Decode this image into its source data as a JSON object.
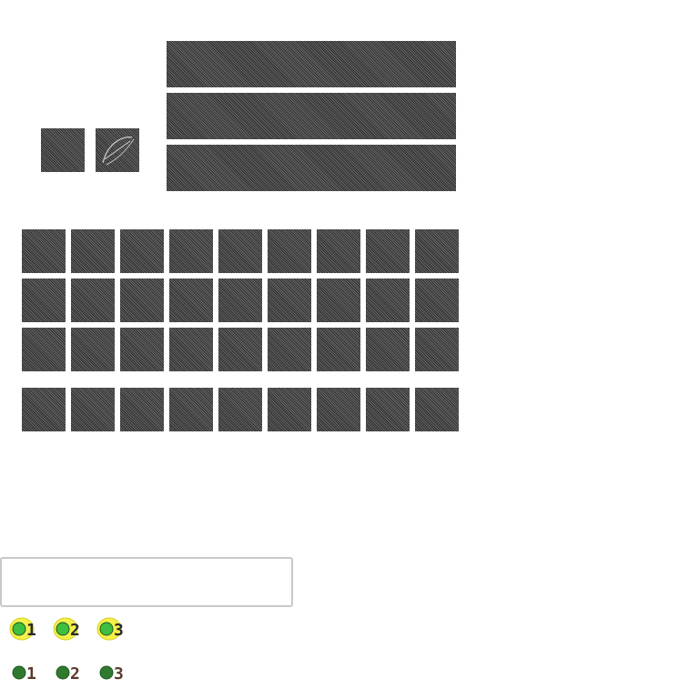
{
  "armor_slots": [
    {
      "name": "armor-slot-empty",
      "icon": "none"
    },
    {
      "name": "armor-slot-bow",
      "icon": "bow-sketch-icon"
    }
  ],
  "crafting_rows": 3,
  "inventory": {
    "main_rows": 3,
    "columns": 9,
    "hotbar_columns": 9
  },
  "chat_input": {
    "value": "",
    "placeholder": ""
  },
  "level_badges_active": [
    {
      "label": "1",
      "color": "#f4f04a",
      "gem": "#3fbf3f"
    },
    {
      "label": "2",
      "color": "#f4f04a",
      "gem": "#3fbf3f"
    },
    {
      "label": "3",
      "color": "#f4f04a",
      "gem": "#3fbf3f"
    }
  ],
  "level_badges_inactive": [
    {
      "label": "1",
      "color": "#5a3a2a",
      "gem": "#2f7a2f"
    },
    {
      "label": "2",
      "color": "#5a3a2a",
      "gem": "#2f7a2f"
    },
    {
      "label": "3",
      "color": "#5a3a2a",
      "gem": "#2f7a2f"
    }
  ],
  "colors": {
    "slot_dark": "#2b2b2b",
    "slot_light": "#6a6a6a",
    "border": "#c8c8c8"
  }
}
